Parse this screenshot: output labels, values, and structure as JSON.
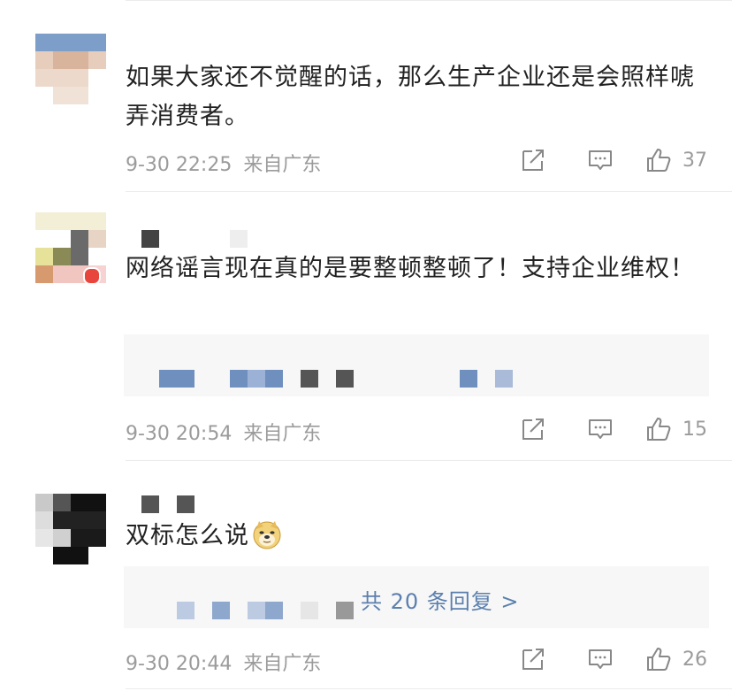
{
  "comments": [
    {
      "text": "如果大家还不觉醒的话，那么生产企业还是会照样唬弄消费者。",
      "date": "9-30 22:25",
      "location": "来自广东",
      "likes": "37"
    },
    {
      "text": "网络谣言现在真的是要整顿整顿了！支持企业维权！",
      "date": "9-30 20:54",
      "location": "来自广东",
      "likes": "15"
    },
    {
      "text": "双标怎么说",
      "emoji": "doge-emoji",
      "date": "9-30 20:44",
      "location": "来自广东",
      "likes": "26",
      "more_replies": "共 20 条回复 >"
    }
  ],
  "icons": {
    "share": "share-icon",
    "reply": "comment-icon",
    "like": "thumbs-up-icon"
  },
  "colors": {
    "text": "#222222",
    "meta": "#9b9b9b",
    "link": "#5b7fae",
    "reply_bg": "#f7f7f7"
  }
}
